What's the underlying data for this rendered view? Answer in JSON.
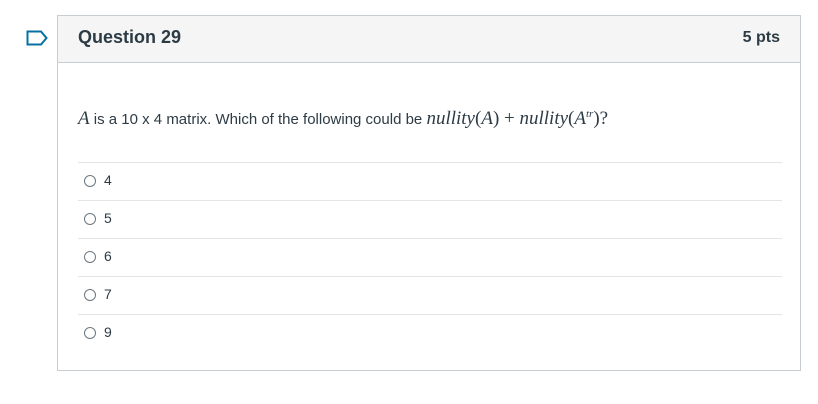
{
  "flag_icon": "bookmark-flag-outline-icon",
  "accent_color": "#0770a3",
  "question": {
    "title": "Question 29",
    "points": "5 pts",
    "text": {
      "var_a": "A",
      "part1": " is a 10 x 4 matrix.  Which of the following could be ",
      "nullity1": "nullity",
      "open1": "(",
      "a1": "A",
      "close1": ")",
      "plus": " + ",
      "nullity2": "nullity",
      "open2": "(",
      "a2": "A",
      "sup": "tr",
      "close2": ")?"
    },
    "answers": [
      {
        "label": "4",
        "selected": false
      },
      {
        "label": "5",
        "selected": false
      },
      {
        "label": "6",
        "selected": false
      },
      {
        "label": "7",
        "selected": false
      },
      {
        "label": "9",
        "selected": false
      }
    ]
  }
}
